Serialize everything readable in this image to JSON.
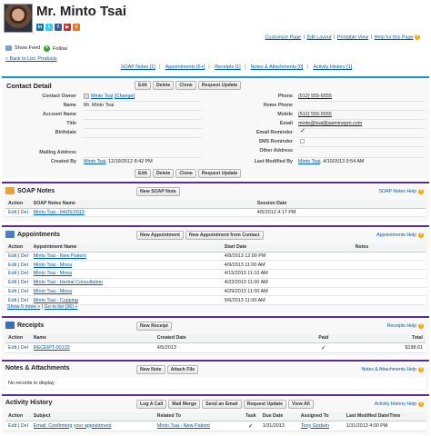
{
  "header": {
    "title": "Mr. Minto Tsai",
    "social_icons": [
      "linkedin-icon",
      "twitter-icon",
      "facebook-icon",
      "youtube-icon",
      "klout-icon"
    ],
    "top_links": [
      "Customize Page",
      "Edit Layout",
      "Printable View",
      "Help for this Page"
    ],
    "top_links_seps": [
      "|",
      "|",
      "|"
    ],
    "help_mark": "?"
  },
  "feed": {
    "show_feed": "Show Feed",
    "follow": "Follow"
  },
  "back_link": "« Back to List: Products",
  "related_links": [
    "SOAP Notes [1]",
    "Appointments [6+]",
    "Receipts [1]",
    "Notes & Attachments [0]",
    "Activity History [1]"
  ],
  "related_links_seps": [
    "|",
    "|",
    "|",
    "|"
  ],
  "detail": {
    "title": "Contact Detail",
    "buttons": [
      "Edit",
      "Delete",
      "Clone",
      "Request Update"
    ],
    "left": {
      "contact_owner_label": "Contact Owner",
      "contact_owner": "Minto Tsai",
      "change": "[Change]",
      "name_label": "Name",
      "name": "Mr. Minto Tsai",
      "account_label": "Account Name",
      "title_label": "Title",
      "birthdate_label": "Birthdate",
      "mailing_label": "Mailing Address",
      "created_by_label": "Created By",
      "created_by": "Minto Tsai",
      "created_date": ", 12/19/2012 8:42 PM"
    },
    "right": {
      "phone_label": "Phone",
      "phone": "(512) 555-5555",
      "home_phone_label": "Home Phone",
      "mobile_label": "Mobile",
      "mobile": "(512) 555-5555",
      "email_label": "Email",
      "email": "minto@tsai@jasminepm.com",
      "email_reminder_label": "Email Reminder",
      "email_reminder": true,
      "sms_reminder_label": "SMS Reminder",
      "sms_reminder": false,
      "other_address_label": "Other Address",
      "modified_by_label": "Last Modified By",
      "modified_by": "Minto Tsai",
      "modified_date": ", 4/10/2013 9:54 AM"
    },
    "check_mark": "✓"
  },
  "soap": {
    "title": "SOAP Notes",
    "button": "New SOAP Note",
    "help": "SOAP Notes Help",
    "columns": [
      "Action",
      "SOAP Notes Name",
      "Session Date"
    ],
    "rows": [
      {
        "edit": "Edit",
        "del": "Del",
        "name": "Minto Tsai - 04/05/2013",
        "date": "4/5/2013 4:17 PM"
      }
    ]
  },
  "appointments": {
    "title": "Appointments",
    "buttons": [
      "New Appointment",
      "New Appointment from Contact"
    ],
    "help": "Appointments Help",
    "columns": [
      "Action",
      "Appointment Name",
      "Start Date",
      "Notes"
    ],
    "rows": [
      {
        "edit": "Edit",
        "del": "Del",
        "name": "Minto Tsai - New Patient",
        "date": "4/8/2013 12:00 PM"
      },
      {
        "edit": "Edit",
        "del": "Del",
        "name": "Minto Tsai - Moxa",
        "date": "4/9/2013 11:00 AM"
      },
      {
        "edit": "Edit",
        "del": "Del",
        "name": "Minto Tsai - Moxa",
        "date": "4/15/2013 11:10 AM"
      },
      {
        "edit": "Edit",
        "del": "Del",
        "name": "Minto Tsai - Herbal Consultation",
        "date": "4/22/2013 11:00 AM"
      },
      {
        "edit": "Edit",
        "del": "Del",
        "name": "Minto Tsai - Moxa",
        "date": "4/29/2013 11:00 AM"
      },
      {
        "edit": "Edit",
        "del": "Del",
        "name": "Minto Tsai - Cupping",
        "date": "5/6/2013 11:00 AM"
      }
    ],
    "show_more": "Show 5 more »",
    "go_to_list": "Go to list (36) »",
    "show_more_sep": "|"
  },
  "receipts": {
    "title": "Receipts",
    "button": "New Receipt",
    "help": "Receipts Help",
    "columns": [
      "Action",
      "Name",
      "Created Date",
      "Paid",
      "Total"
    ],
    "rows": [
      {
        "edit": "Edit",
        "del": "Del",
        "name": "RECEIPT-00133",
        "date": "4/5/2013",
        "paid": true,
        "total": "$198.61"
      }
    ]
  },
  "notes": {
    "title": "Notes & Attachments",
    "buttons": [
      "New Note",
      "Attach File"
    ],
    "help": "Notes & Attachments Help",
    "empty": "No records to display"
  },
  "activity": {
    "title": "Activity History",
    "buttons": [
      "Log A Call",
      "Mail Merge",
      "Send an Email",
      "Request Update",
      "View All"
    ],
    "help": "Activity History Help",
    "columns": [
      "Action",
      "Subject",
      "Related To",
      "Task",
      "Due Date",
      "Assigned To",
      "Last Modified Date/Time"
    ],
    "rows": [
      {
        "edit": "Edit",
        "del": "Del",
        "subject": "Email: Confirming your appointment",
        "related": "Minto Tsai - New Patient",
        "task": true,
        "due": "1/31/2013",
        "assigned": "Tony Godwin",
        "modified": "1/31/2013 4:00 PM"
      }
    ]
  },
  "colors": {
    "accent": "#1797c0",
    "list_border": "#5a2e8c",
    "link": "#015ba7"
  }
}
